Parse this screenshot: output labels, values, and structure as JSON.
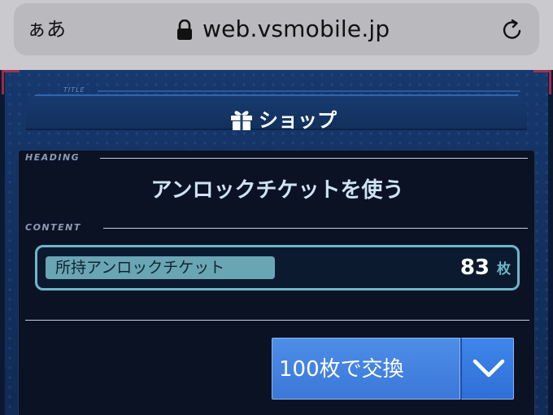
{
  "browser": {
    "text_size_button": "ぁあ",
    "url": "web.vsmobile.jp",
    "icons": {
      "lock": "lock-icon",
      "reload": "reload-icon"
    }
  },
  "page": {
    "title_tag": "TITLE",
    "title": "ショップ",
    "title_icon": "gift-icon"
  },
  "panel": {
    "heading_tag": "HEADING",
    "heading": "アンロックチケットを使う",
    "content_tag": "CONTENT",
    "ticket": {
      "label": "所持アンロックチケット",
      "count": "83",
      "unit": "枚"
    },
    "exchange": {
      "selected": "100枚で交換",
      "arrow_icon": "chevron-down-icon"
    }
  },
  "colors": {
    "accent_blue": "#3b78d8",
    "ticket_border": "#6cb7c9",
    "heading_text": "#cfe3f1",
    "panel_bg": "#0a1224"
  }
}
